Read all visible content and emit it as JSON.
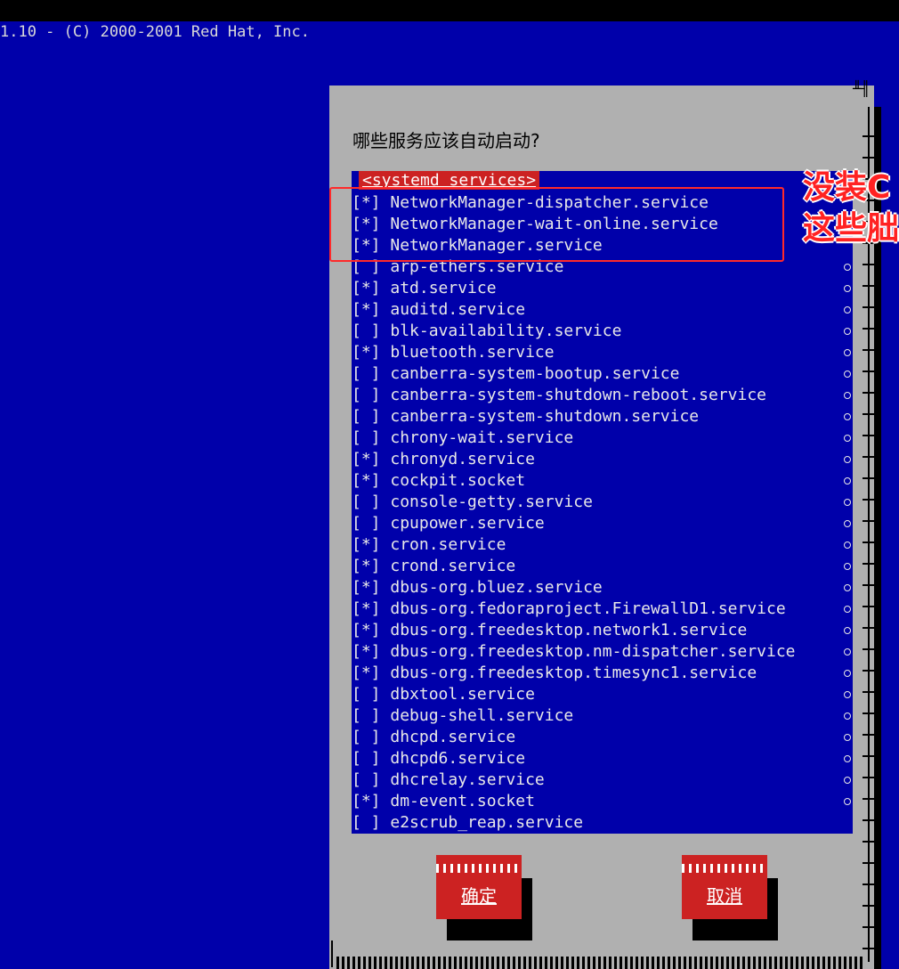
{
  "status_bar": {
    "text": "1.10 - (C) 2000-2001 Red Hat, Inc."
  },
  "dialog": {
    "prompt": "哪些服务应该自动启动?",
    "list_header": "<systemd services>",
    "services": [
      {
        "check": "[*]",
        "name": "NetworkManager-dispatcher.service"
      },
      {
        "check": "[*]",
        "name": "NetworkManager-wait-online.service"
      },
      {
        "check": "[*]",
        "name": "NetworkManager.service"
      },
      {
        "check": "[ ]",
        "name": "arp-ethers.service"
      },
      {
        "check": "[*]",
        "name": "atd.service"
      },
      {
        "check": "[*]",
        "name": "auditd.service"
      },
      {
        "check": "[ ]",
        "name": "blk-availability.service"
      },
      {
        "check": "[*]",
        "name": "bluetooth.service"
      },
      {
        "check": "[ ]",
        "name": "canberra-system-bootup.service"
      },
      {
        "check": "[ ]",
        "name": "canberra-system-shutdown-reboot.service"
      },
      {
        "check": "[ ]",
        "name": "canberra-system-shutdown.service"
      },
      {
        "check": "[ ]",
        "name": "chrony-wait.service"
      },
      {
        "check": "[*]",
        "name": "chronyd.service"
      },
      {
        "check": "[*]",
        "name": "cockpit.socket"
      },
      {
        "check": "[ ]",
        "name": "console-getty.service"
      },
      {
        "check": "[ ]",
        "name": "cpupower.service"
      },
      {
        "check": "[*]",
        "name": "cron.service"
      },
      {
        "check": "[*]",
        "name": "crond.service"
      },
      {
        "check": "[*]",
        "name": "dbus-org.bluez.service"
      },
      {
        "check": "[*]",
        "name": "dbus-org.fedoraproject.FirewallD1.service"
      },
      {
        "check": "[*]",
        "name": "dbus-org.freedesktop.network1.service"
      },
      {
        "check": "[*]",
        "name": "dbus-org.freedesktop.nm-dispatcher.service"
      },
      {
        "check": "[*]",
        "name": "dbus-org.freedesktop.timesync1.service"
      },
      {
        "check": "[ ]",
        "name": "dbxtool.service"
      },
      {
        "check": "[ ]",
        "name": "debug-shell.service"
      },
      {
        "check": "[ ]",
        "name": "dhcpd.service"
      },
      {
        "check": "[ ]",
        "name": "dhcpd6.service"
      },
      {
        "check": "[ ]",
        "name": "dhcrelay.service"
      },
      {
        "check": "[*]",
        "name": "dm-event.socket"
      },
      {
        "check": "[ ]",
        "name": "e2scrub_reap.service"
      }
    ],
    "ok_label": "确定",
    "cancel_label": "取消"
  },
  "annotation": {
    "line1": "没装C",
    "line2": "这些胐"
  },
  "colors": {
    "screen_bg": "#0000aa",
    "dialog_bg": "#b0b0b0",
    "accent": "#cc2222",
    "annotation": "#ff2222"
  }
}
